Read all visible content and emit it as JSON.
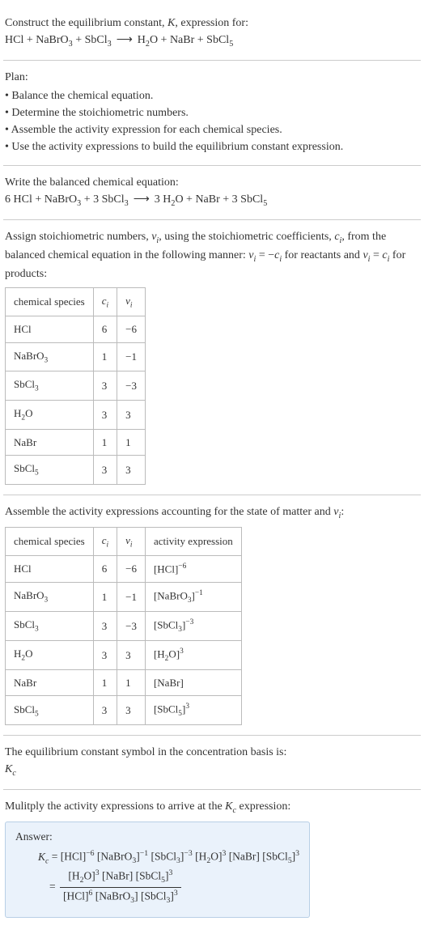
{
  "intro": {
    "line1": "Construct the equilibrium constant, K, expression for:",
    "equation": "HCl + NaBrO₃ + SbCl₃  ⟶  H₂O + NaBr + SbCl₅"
  },
  "plan": {
    "title": "Plan:",
    "items": [
      "• Balance the chemical equation.",
      "• Determine the stoichiometric numbers.",
      "• Assemble the activity expression for each chemical species.",
      "• Use the activity expressions to build the equilibrium constant expression."
    ]
  },
  "balanced": {
    "title": "Write the balanced chemical equation:",
    "equation": "6 HCl + NaBrO₃ + 3 SbCl₃  ⟶  3 H₂O + NaBr + 3 SbCl₅"
  },
  "assign": {
    "text": "Assign stoichiometric numbers, νᵢ, using the stoichiometric coefficients, cᵢ, from the balanced chemical equation in the following manner: νᵢ = −cᵢ for reactants and νᵢ = cᵢ for products:",
    "headers": [
      "chemical species",
      "cᵢ",
      "νᵢ"
    ],
    "rows": [
      {
        "sp": "HCl",
        "c": "6",
        "v": "−6"
      },
      {
        "sp": "NaBrO₃",
        "c": "1",
        "v": "−1"
      },
      {
        "sp": "SbCl₃",
        "c": "3",
        "v": "−3"
      },
      {
        "sp": "H₂O",
        "c": "3",
        "v": "3"
      },
      {
        "sp": "NaBr",
        "c": "1",
        "v": "1"
      },
      {
        "sp": "SbCl₅",
        "c": "3",
        "v": "3"
      }
    ]
  },
  "activity": {
    "text": "Assemble the activity expressions accounting for the state of matter and νᵢ:",
    "headers": [
      "chemical species",
      "cᵢ",
      "νᵢ",
      "activity expression"
    ],
    "rows": [
      {
        "sp": "HCl",
        "c": "6",
        "v": "−6",
        "a": "[HCl]⁻⁶"
      },
      {
        "sp": "NaBrO₃",
        "c": "1",
        "v": "−1",
        "a": "[NaBrO₃]⁻¹"
      },
      {
        "sp": "SbCl₃",
        "c": "3",
        "v": "−3",
        "a": "[SbCl₃]⁻³"
      },
      {
        "sp": "H₂O",
        "c": "3",
        "v": "3",
        "a": "[H₂O]³"
      },
      {
        "sp": "NaBr",
        "c": "1",
        "v": "1",
        "a": "[NaBr]"
      },
      {
        "sp": "SbCl₅",
        "c": "3",
        "v": "3",
        "a": "[SbCl₅]³"
      }
    ]
  },
  "symbol": {
    "line1": "The equilibrium constant symbol in the concentration basis is:",
    "line2": "K_c"
  },
  "multiply": {
    "text": "Mulitply the activity expressions to arrive at the K_c expression:"
  },
  "answer": {
    "title": "Answer:",
    "line1_pre": "K_c = [HCl]⁻⁶ [NaBrO₃]⁻¹ [SbCl₃]⁻³ [H₂O]³ [NaBr] [SbCl₅]³",
    "eq": "=",
    "num": "[H₂O]³ [NaBr] [SbCl₅]³",
    "den": "[HCl]⁶ [NaBrO₃] [SbCl₃]³"
  }
}
